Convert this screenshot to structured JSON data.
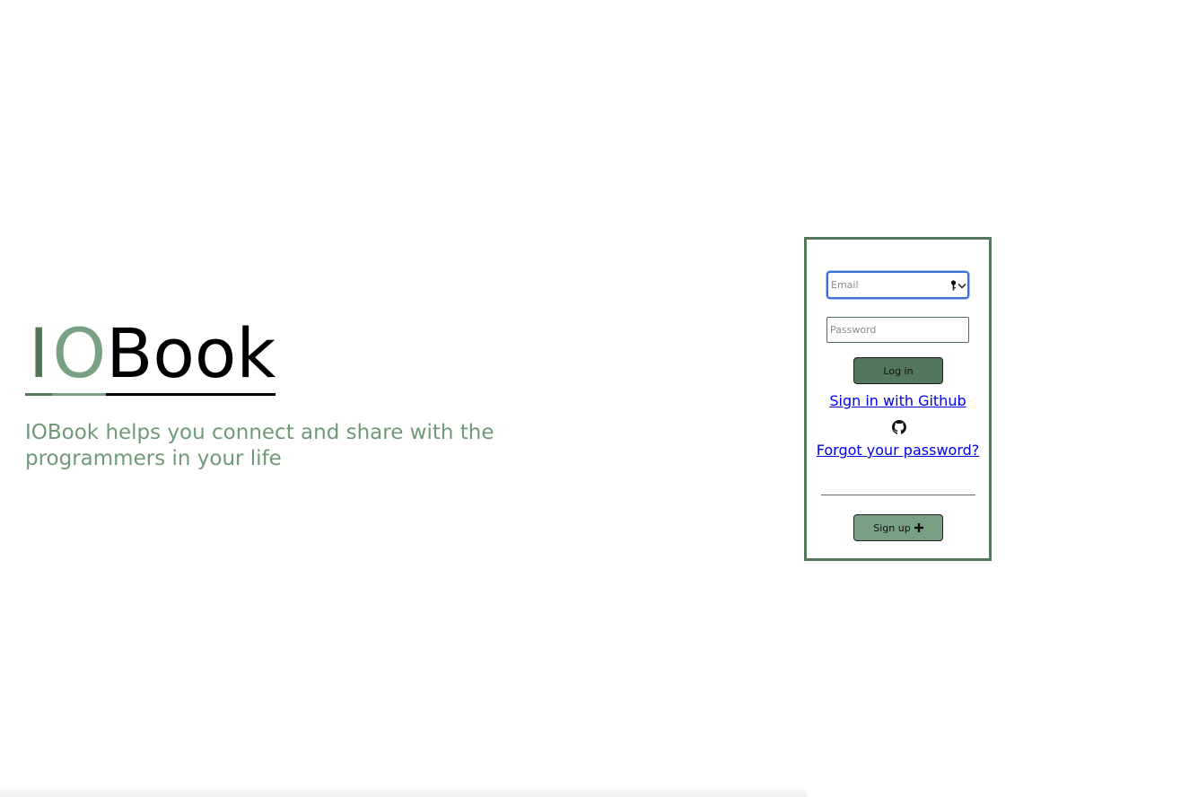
{
  "hero": {
    "logo_part1": "I",
    "logo_part2": "O",
    "logo_part3": "Book",
    "tagline": "IOBook helps you connect and share with the programmers in your life"
  },
  "login": {
    "email_placeholder": "Email",
    "email_value": "",
    "password_placeholder": "Password",
    "password_value": "",
    "login_label": "Log in",
    "github_link": "Sign in with Github",
    "forgot_link": "Forgot your password?",
    "signup_label": "Sign up"
  },
  "icons": {
    "password_manager": "key-icon",
    "dropdown": "chevron-down-icon",
    "github": "github-icon",
    "plus": "plus-icon"
  },
  "colors": {
    "accent_dark": "#52775a",
    "accent_light": "#7aa083",
    "tagline": "#6e9a78",
    "link": "#0000ee",
    "focus_ring": "#3d6fd6"
  }
}
